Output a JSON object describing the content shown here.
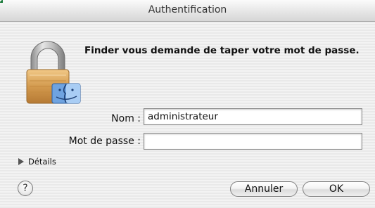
{
  "window": {
    "title": "Authentification"
  },
  "dialog": {
    "prompt": "Finder vous demande de taper votre mot de passe.",
    "fields": {
      "name": {
        "label": "Nom :",
        "value": "administrateur"
      },
      "password": {
        "label": "Mot de passe :",
        "value": ""
      }
    },
    "details_label": "Détails",
    "help_label": "?",
    "buttons": {
      "cancel": "Annuler",
      "ok": "OK"
    }
  },
  "icons": {
    "lock": "lock-icon",
    "finder": "finder-icon",
    "disclosure": "disclosure-triangle-icon",
    "help": "help-icon"
  },
  "colors": {
    "titlebar": "#e6e6e6",
    "background": "#efefef",
    "lock_body": "#d39a4e"
  }
}
